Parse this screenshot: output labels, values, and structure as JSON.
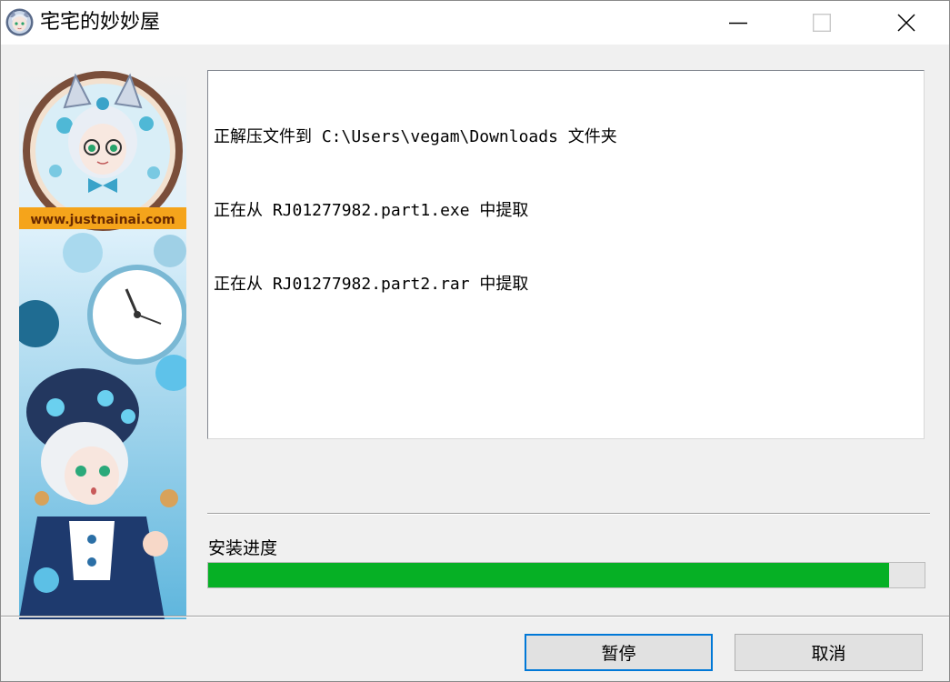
{
  "window": {
    "title": "宅宅的妙妙屋",
    "controls": {
      "minimize_icon": "minimize-icon",
      "maximize_icon": "maximize-icon",
      "close_icon": "close-icon"
    }
  },
  "banner": {
    "watermark": "www.justnainai.com"
  },
  "log": {
    "lines": [
      "正解压文件到 C:\\Users\\vegam\\Downloads 文件夹",
      "正在从 RJ01277982.part1.exe 中提取",
      "正在从 RJ01277982.part2.rar 中提取"
    ]
  },
  "progress": {
    "label": "安装进度",
    "percent": 95,
    "fill_color": "#06b025"
  },
  "buttons": {
    "pause_label": "暂停",
    "cancel_label": "取消"
  },
  "colors": {
    "focus_border": "#0078d7"
  }
}
